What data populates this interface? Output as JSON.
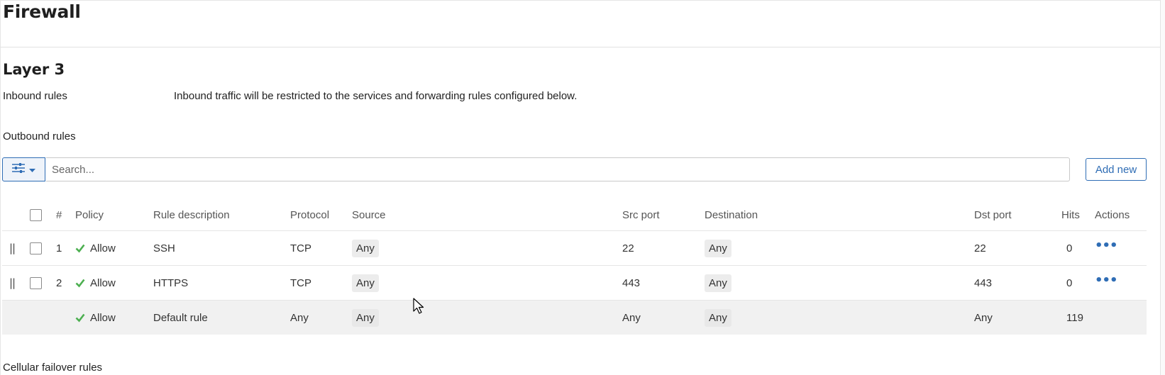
{
  "page": {
    "title": "Firewall"
  },
  "layer3": {
    "title": "Layer 3",
    "inbound_label": "Inbound rules",
    "inbound_desc": "Inbound traffic will be restricted to the services and forwarding rules configured below.",
    "outbound_label": "Outbound rules"
  },
  "toolbar": {
    "filter_icon": "sliders-icon",
    "search_placeholder": "Search...",
    "add_label": "Add new"
  },
  "table": {
    "headers": {
      "num": "#",
      "policy": "Policy",
      "description": "Rule description",
      "protocol": "Protocol",
      "source": "Source",
      "src_port": "Src port",
      "destination": "Destination",
      "dst_port": "Dst port",
      "hits": "Hits",
      "actions": "Actions"
    },
    "rows": [
      {
        "num": "1",
        "policy": "Allow",
        "description": "SSH",
        "protocol": "TCP",
        "source": "Any",
        "src_port": "22",
        "destination": "Any",
        "dst_port": "22",
        "hits": "0"
      },
      {
        "num": "2",
        "policy": "Allow",
        "description": "HTTPS",
        "protocol": "TCP",
        "source": "Any",
        "src_port": "443",
        "destination": "Any",
        "dst_port": "443",
        "hits": "0"
      }
    ],
    "default_row": {
      "policy": "Allow",
      "description": "Default rule",
      "protocol": "Any",
      "source": "Any",
      "src_port": "Any",
      "destination": "Any",
      "dst_port": "Any",
      "hits": "119"
    }
  },
  "cellular": {
    "label": "Cellular failover rules"
  },
  "colors": {
    "accent": "#2f6db5",
    "allow_green": "#4caf50",
    "row_default_bg": "#f1f1f1"
  }
}
